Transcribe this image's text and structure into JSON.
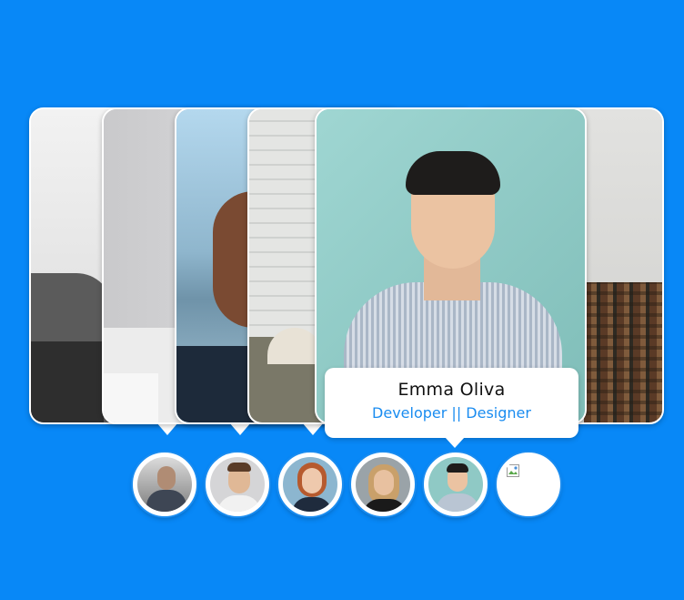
{
  "profile": {
    "name": "Emma Oliva",
    "role": "Developer || Designer"
  },
  "colors": {
    "background": "#0888f7",
    "accent": "#1a8cf0",
    "card_border": "#ffffff"
  },
  "thumbnails": [
    {
      "id": "person-1",
      "selected": false
    },
    {
      "id": "person-2",
      "selected": false
    },
    {
      "id": "person-3",
      "selected": false
    },
    {
      "id": "person-4",
      "selected": false
    },
    {
      "id": "person-5",
      "selected": true
    },
    {
      "id": "person-6",
      "selected": false,
      "image_broken": true
    }
  ]
}
